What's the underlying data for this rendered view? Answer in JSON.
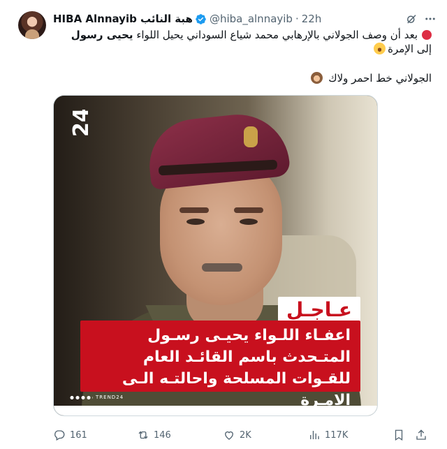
{
  "author": {
    "display_name": "HIBA Alnnayib هبة النائب",
    "handle": "@hiba_alnnayib",
    "separator": "·",
    "time": "22h"
  },
  "tweet": {
    "line1_part1": "بعد أن وصف الجولاني بالإرهابي محمد شياع السوداني يحيل اللواء",
    "line1_bold": "يحيى رسول",
    "line1_part2": "إلى الإمرة",
    "line2": "الجولاني خط احمر ولاك"
  },
  "media": {
    "logo_text": "24",
    "urgent_label": "عـاجـل",
    "headline": "اعفـاء اللـواء يحيـى رسـول المتـحدث باسم القائـد العام للقـوات المسلحة واحالتـه الـى الامـرة",
    "watermark": "TREND24"
  },
  "actions": {
    "replies": "161",
    "reposts": "146",
    "likes": "2K",
    "views": "117K"
  },
  "icons": [
    "verified-icon",
    "grok-icon",
    "more-icon",
    "reply-icon",
    "repost-icon",
    "like-icon",
    "views-icon",
    "bookmark-icon",
    "share-icon"
  ],
  "colors": {
    "verified": "#1d9bf0",
    "headline_bg": "#c8101e",
    "muted": "#536471"
  }
}
